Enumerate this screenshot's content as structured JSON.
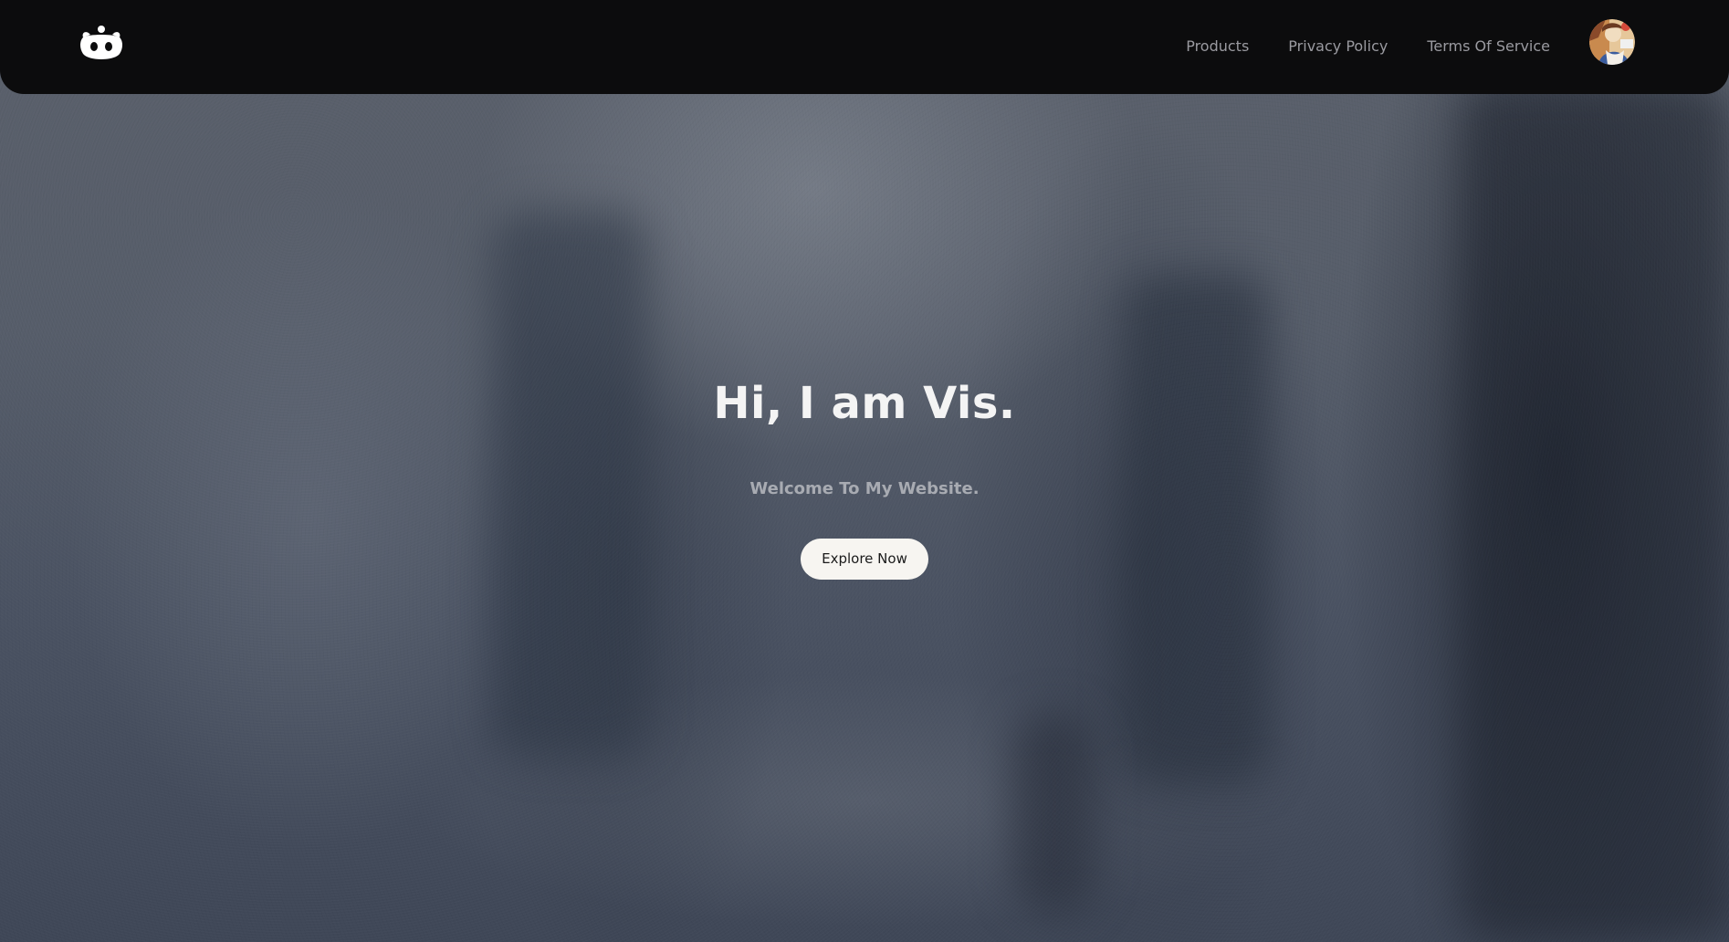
{
  "nav": {
    "logo_icon": "panda-face-icon",
    "links": [
      {
        "label": "Products"
      },
      {
        "label": "Privacy Policy"
      },
      {
        "label": "Terms Of Service"
      }
    ],
    "avatar_icon": "user-avatar-icon"
  },
  "hero": {
    "title": "Hi, I am Vis.",
    "subtitle": "Welcome To My Website.",
    "button_label": "Explore Now"
  },
  "colors": {
    "navbar_bg": "#0c0c0d",
    "nav_link": "#9a9aa0",
    "title": "#f4f4f4",
    "subtitle": "#a8abb2",
    "button_bg": "#f7f5f1",
    "button_text": "#1b1b1b"
  }
}
